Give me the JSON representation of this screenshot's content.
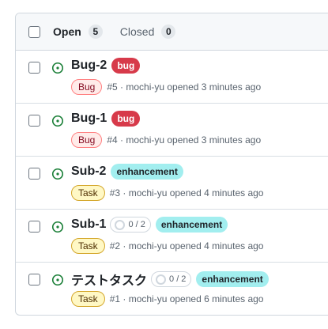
{
  "header": {
    "open_label": "Open",
    "open_count": "5",
    "closed_label": "Closed",
    "closed_count": "0"
  },
  "issues": [
    {
      "title": "Bug-2",
      "label": "bug",
      "label_kind": "bug",
      "subtasks": "",
      "type": "Bug",
      "meta": "#5 · mochi-yu opened 3 minutes ago"
    },
    {
      "title": "Bug-1",
      "label": "bug",
      "label_kind": "bug",
      "subtasks": "",
      "type": "Bug",
      "meta": "#4 · mochi-yu opened 3 minutes ago"
    },
    {
      "title": "Sub-2",
      "label": "enhancement",
      "label_kind": "enhancement",
      "subtasks": "",
      "type": "Task",
      "meta": "#3 · mochi-yu opened 4 minutes ago"
    },
    {
      "title": "Sub-1",
      "label": "enhancement",
      "label_kind": "enhancement",
      "subtasks": "0 / 2",
      "type": "Task",
      "meta": "#2 · mochi-yu opened 4 minutes ago"
    },
    {
      "title": "テストタスク",
      "label": "enhancement",
      "label_kind": "enhancement",
      "subtasks": "0 / 2",
      "type": "Task",
      "meta": "#1 · mochi-yu opened 6 minutes ago"
    }
  ],
  "colors": {
    "open_icon": "#1a7f37",
    "bug_label": "#d73a4a",
    "enhancement_label": "#a2eeef"
  },
  "icons": {
    "status": "issue-opened-icon",
    "subtasks": "progress-circle-icon"
  }
}
